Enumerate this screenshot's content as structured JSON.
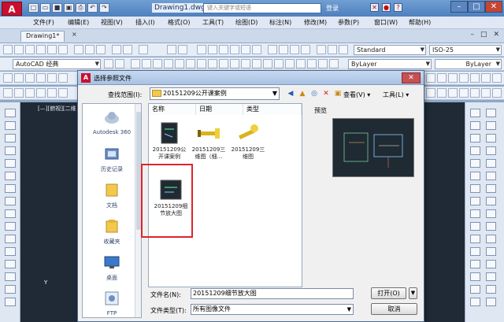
{
  "app": {
    "logo": "A",
    "document_title": "Drawing1.dwg",
    "help_search_placeholder": "键入关键字或短语",
    "login_label": "登录"
  },
  "menu": [
    "文件(F)",
    "编辑(E)",
    "视图(V)",
    "插入(I)",
    "格式(O)",
    "工具(T)",
    "绘图(D)",
    "标注(N)",
    "修改(M)",
    "参数(P)",
    "窗口(W)",
    "帮助(H)"
  ],
  "tabs": {
    "drawing_tab": "Drawing1*",
    "close_symbol": "×"
  },
  "toolbar": {
    "text_style": "Standard",
    "dim_style": "ISO-25",
    "workspace": "AutoCAD 经典",
    "layer": "ByLayer",
    "linetype": "ByLayer"
  },
  "drawing": {
    "view_label": "[—][俯视][二维",
    "y_axis": "Y"
  },
  "dialog": {
    "title": "选择参照文件",
    "look_in_label": "查找范围(I):",
    "look_in_value": "20151209公开课案例",
    "view_menu": "查看(V)",
    "tools_menu": "工具(L)",
    "places": [
      {
        "label": "Autodesk 360",
        "icon": "cloud-icon"
      },
      {
        "label": "历史记录",
        "icon": "history-icon"
      },
      {
        "label": "文档",
        "icon": "documents-icon"
      },
      {
        "label": "收藏夹",
        "icon": "favorites-icon"
      },
      {
        "label": "桌面",
        "icon": "desktop-icon"
      },
      {
        "label": "FTP",
        "icon": "ftp-icon"
      }
    ],
    "columns": [
      "名称",
      "日期",
      "类型"
    ],
    "files": [
      {
        "name": "20151209公开课案例",
        "thumb": "dark"
      },
      {
        "name": "20151209三维图（细…",
        "thumb": "yellow"
      },
      {
        "name": "20151209三维图",
        "thumb": "yellow"
      },
      {
        "name": "20151209细节放大图",
        "thumb": "dark",
        "selected": true
      }
    ],
    "preview_label": "预览",
    "file_name_label": "文件名(N):",
    "file_name_value": "20151209细节放大图",
    "file_type_label": "文件类型(T):",
    "file_type_value": "所有图像文件",
    "open_button": "打开(O)",
    "cancel_button": "取消"
  },
  "colors": {
    "accent": "#c8102e",
    "highlight": "#e0232b",
    "canvas": "#202a36"
  }
}
